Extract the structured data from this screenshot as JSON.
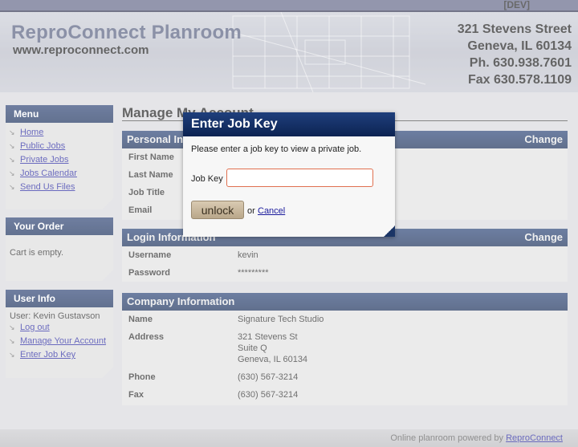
{
  "env_label": "[DEV]",
  "header": {
    "title": "ReproConnect Planroom",
    "url": "www.reproconnect.com",
    "contact": [
      "321 Stevens Street",
      "Geneva, IL 60134",
      "Ph. 630.938.7601",
      "Fax 630.578.1109"
    ]
  },
  "sidebar": {
    "menu": {
      "title": "Menu",
      "items": [
        {
          "label": "Home"
        },
        {
          "label": "Public Jobs"
        },
        {
          "label": "Private Jobs"
        },
        {
          "label": "Jobs Calendar"
        },
        {
          "label": "Send Us Files"
        }
      ]
    },
    "order": {
      "title": "Your Order",
      "text": "Cart is empty."
    },
    "user": {
      "title": "User Info",
      "user_line": "User: Kevin Gustavson",
      "items": [
        {
          "label": "Log out"
        },
        {
          "label": "Manage Your Account"
        },
        {
          "label": "Enter Job Key"
        }
      ]
    }
  },
  "main": {
    "title": "Manage My Account",
    "personal": {
      "title": "Personal Information",
      "change": "Change",
      "rows": [
        {
          "label": "First Name",
          "value": ""
        },
        {
          "label": "Last Name",
          "value": ""
        },
        {
          "label": "Job Title",
          "value": ""
        },
        {
          "label": "Email",
          "value": ""
        }
      ]
    },
    "login": {
      "title": "Login Information",
      "change": "Change",
      "rows": [
        {
          "label": "Username",
          "value": "kevin"
        },
        {
          "label": "Password",
          "value": "*********"
        }
      ]
    },
    "company": {
      "title": "Company Information",
      "name_label": "Name",
      "name_value": "Signature Tech Studio",
      "address_label": "Address",
      "address_lines": [
        "321 Stevens St",
        "Suite Q",
        "Geneva, IL 60134"
      ],
      "phone_label": "Phone",
      "phone_value": "(630) 567-3214",
      "fax_label": "Fax",
      "fax_value": "(630) 567-3214"
    }
  },
  "footer": {
    "text": "Online planroom powered by",
    "link": "ReproConnect"
  },
  "dialog": {
    "title": "Enter Job Key",
    "message": "Please enter a job key to view a private job.",
    "field_label": "Job Key",
    "field_value": "",
    "button": "unlock",
    "or_text": "or",
    "cancel": "Cancel"
  }
}
